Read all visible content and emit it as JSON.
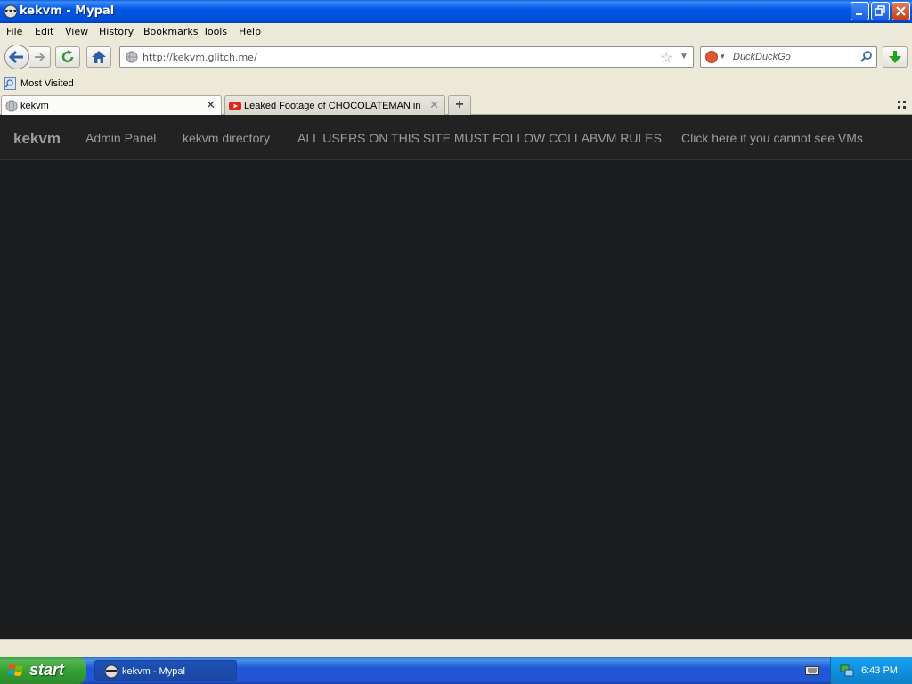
{
  "window": {
    "title": "kekvm - Mypal"
  },
  "menu": {
    "items": [
      "File",
      "Edit",
      "View",
      "History",
      "Bookmarks",
      "Tools",
      "Help"
    ]
  },
  "navigation": {
    "url": "http://kekvm.glitch.me/",
    "search_placeholder": "DuckDuckGo"
  },
  "bookmarks": {
    "most_visited": "Most Visited"
  },
  "tabs": [
    {
      "title": "kekvm",
      "active": true
    },
    {
      "title": "Leaked Footage of CHOCOLATEMAN in di...",
      "active": false
    }
  ],
  "site": {
    "brand": "kekvm",
    "links": [
      "Admin Panel",
      "kekvm directory",
      "ALL USERS ON THIS SITE MUST FOLLOW COLLABVM RULES",
      "Click here if you cannot see VMs"
    ]
  },
  "taskbar": {
    "start_label": "start",
    "task_title": "kekvm - Mypal",
    "clock": "6:43 PM"
  },
  "colors": {
    "page_background": "#1a1c1e",
    "site_nav_background": "#222222",
    "site_nav_text": "#9d9d9d",
    "titlebar_blue": "#0057e5",
    "taskbar_blue": "#2157d7",
    "start_green": "#36a036"
  },
  "icons": {
    "app": "mypal-raccoon-icon",
    "back": "back-arrow-icon",
    "forward": "forward-arrow-icon",
    "reload": "reload-icon",
    "home": "home-icon",
    "site_identity": "globe-icon",
    "bookmark_star": "star-icon",
    "search_engine": "duckduckgo-icon",
    "search": "magnifier-icon",
    "download": "download-arrow-icon",
    "youtube": "youtube-icon"
  }
}
